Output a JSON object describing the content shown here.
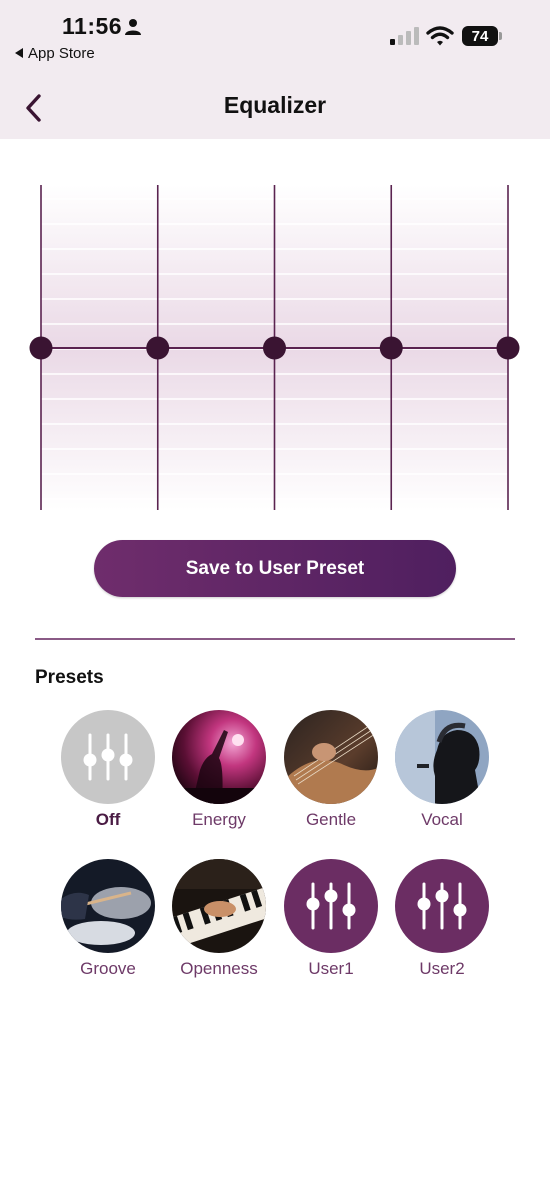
{
  "status_bar": {
    "time": "11:56",
    "back_app": "App Store",
    "battery": "74"
  },
  "header": {
    "title": "Equalizer"
  },
  "equalizer": {
    "bands": 5,
    "gains": [
      0,
      0,
      0,
      0,
      0
    ],
    "accent_color": "#5a2350",
    "knob_color": "#3a1432"
  },
  "actions": {
    "save_label": "Save to User Preset"
  },
  "presets": {
    "title": "Presets",
    "items": [
      {
        "label": "Off",
        "icon": "sliders-icon",
        "selected": true
      },
      {
        "label": "Energy",
        "icon": "concert-photo"
      },
      {
        "label": "Gentle",
        "icon": "guitar-photo"
      },
      {
        "label": "Vocal",
        "icon": "singer-photo"
      },
      {
        "label": "Groove",
        "icon": "drums-photo"
      },
      {
        "label": "Openness",
        "icon": "piano-photo"
      },
      {
        "label": "User1",
        "icon": "sliders-icon"
      },
      {
        "label": "User2",
        "icon": "sliders-icon"
      }
    ]
  },
  "colors": {
    "header_bg": "#f2ebf0",
    "brand_purple": "#6b2d63",
    "label_purple": "#6e3a68"
  }
}
